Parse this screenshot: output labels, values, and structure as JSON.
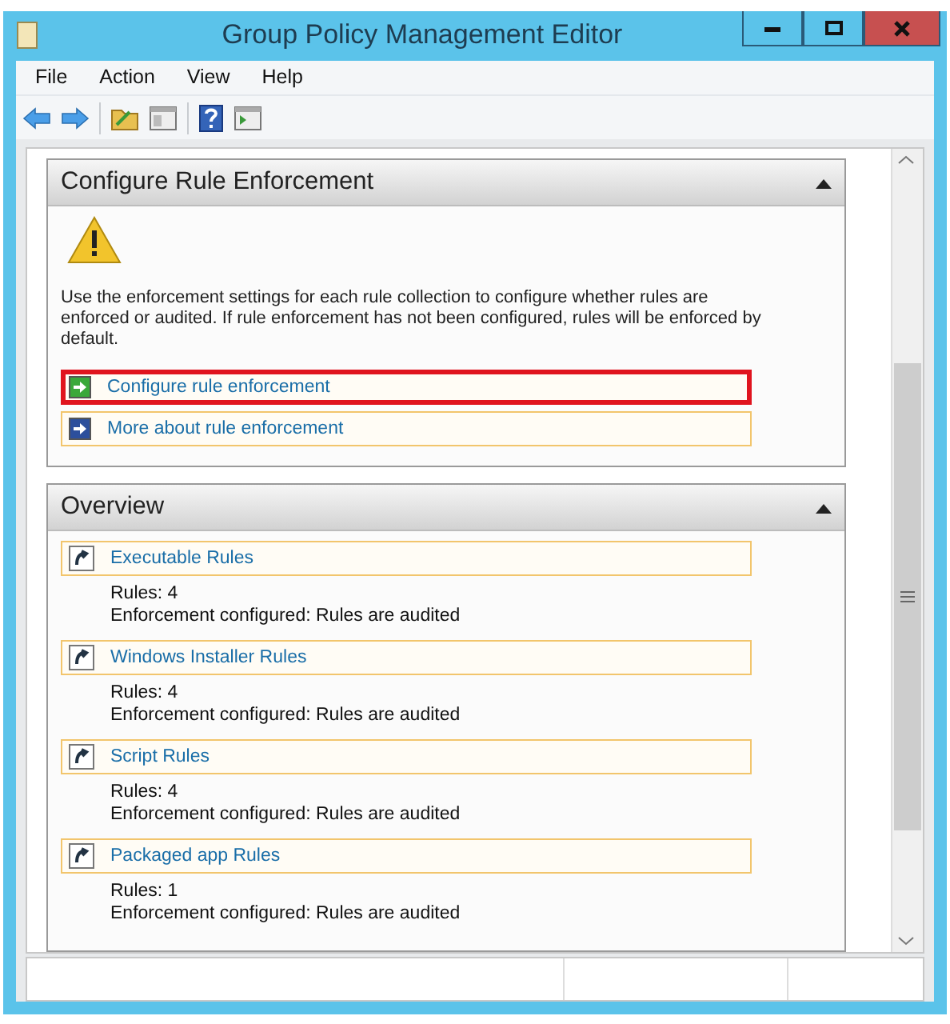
{
  "window": {
    "title": "Group Policy Management Editor"
  },
  "menu": [
    "File",
    "Action",
    "View",
    "Help"
  ],
  "sections": [
    {
      "title": "Configure Rule Enforcement",
      "expanded": true,
      "kind": "info",
      "description": "Use the enforcement settings for each rule collection to configure whether rules are enforced or audited. If rule enforcement has not been configured, rules will be enforced by default.",
      "links": [
        {
          "label": "Configure rule enforcement",
          "highlighted": true
        },
        {
          "label": "More about rule enforcement",
          "highlighted": false
        }
      ]
    },
    {
      "title": "Overview",
      "expanded": true,
      "kind": "rules",
      "items": [
        {
          "label": "Executable Rules",
          "count": "Rules: 4",
          "status": "Enforcement configured: Rules are audited"
        },
        {
          "label": "Windows Installer Rules",
          "count": "Rules: 4",
          "status": "Enforcement configured: Rules are audited"
        },
        {
          "label": "Script Rules",
          "count": "Rules: 4",
          "status": "Enforcement configured: Rules are audited"
        },
        {
          "label": "Packaged app Rules",
          "count": "Rules: 1",
          "status": "Enforcement configured: Rules are audited"
        }
      ]
    }
  ]
}
